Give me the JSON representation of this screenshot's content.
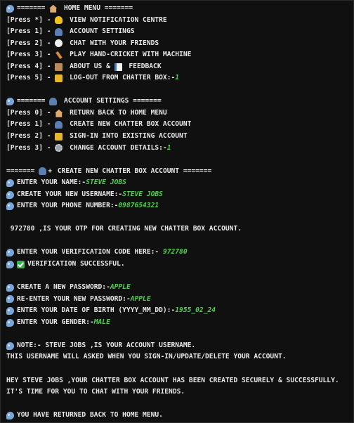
{
  "home_menu": {
    "header": "======= ",
    "header_title": " HOME MENU =======",
    "items": [
      {
        "key": "[Press *] - ",
        "label": " VIEW NOTIFICATION CENTRE",
        "icon": "bell-icon"
      },
      {
        "key": "[Press 1] - ",
        "label": " ACCOUNT SETTINGS",
        "icon": "person-icon"
      },
      {
        "key": "[Press 2] - ",
        "label": " CHAT WITH YOUR FRIENDS",
        "icon": "chat-bubble-icon"
      },
      {
        "key": "[Press 3] - ",
        "label": " PLAY HAND-CRICKET WITH MACHINE",
        "icon": "cricket-bat-icon"
      },
      {
        "key": "[Press 4] - ",
        "label": " ABOUT US & ",
        "label2": " FEEDBACK",
        "icon": "book-icon"
      },
      {
        "key": "[Press 5] - ",
        "label": " LOG-OUT FROM CHATTER BOX:-",
        "icon": "lock-icon"
      }
    ],
    "input": "1"
  },
  "account_menu": {
    "header": "======= ",
    "header_title": " ACCOUNT SETTINGS =======",
    "items": [
      {
        "key": "[Press 0] - ",
        "label": " RETURN BACK TO HOME MENU",
        "icon": "house-icon"
      },
      {
        "key": "[Press 1] - ",
        "label": " CREATE NEW CHATTER BOX ACCOUNT",
        "icon": "person-icon"
      },
      {
        "key": "[Press 2] - ",
        "label": " SIGN-IN INTO EXISTING ACCOUNT",
        "icon": "lock-key-icon"
      },
      {
        "key": "[Press 3] - ",
        "label": " CHANGE ACCOUNT DETAILS:-",
        "icon": "gear-icon"
      }
    ],
    "input": "1"
  },
  "create_account": {
    "header": "======= ",
    "header_plus": "+",
    "header_title": " CREATE NEW CHATTER BOX ACCOUNT =======",
    "name_prompt": "ENTER YOUR NAME:-",
    "name_value": "STEVE JOBS",
    "username_prompt": "CREATE YOUR NEW USERNAME:-",
    "username_value": "STEVE JOBS",
    "phone_prompt": "ENTER YOUR PHONE NUMBER:-",
    "phone_value": "0987654321",
    "otp_message": " 972780 ,IS YOUR OTP FOR CREATING NEW CHATTER BOX ACCOUNT.",
    "code_prompt": "ENTER YOUR VERIFICATION CODE HERE:- ",
    "code_value": "972780",
    "verified": "VERIFICATION SUCCESSFUL.",
    "password_prompt": "CREATE A NEW PASSWORD:-",
    "password_value": "APPLE",
    "reenter_prompt": "RE-ENTER YOUR NEW PASSWORD:-",
    "reenter_value": "APPLE",
    "dob_prompt": "ENTER YOUR DATE OF BIRTH (YYYY_MM_DD):-",
    "dob_value": "1955_02_24",
    "gender_prompt": "ENTER YOUR GENDER:-",
    "gender_value": "MALE"
  },
  "notes": {
    "note_line": "NOTE:- STEVE JOBS ,IS YOUR ACCOUNT USERNAME.",
    "note_line2": "THIS USERNAME WILL ASKED WHEN YOU SIGN-IN/UPDATE/DELETE YOUR ACCOUNT.",
    "success_line": "HEY STEVE JOBS ,YOUR CHATTER BOX ACCOUNT HAS BEEN CREATED SECURELY & SUCCESSFULLY.",
    "success_line2": "IT'S TIME FOR YOU TO CHAT WITH YOUR FRIENDS.",
    "return_line": "YOU HAVE RETURNED BACK TO HOME MENU."
  },
  "colors": {
    "background": "#101010",
    "text": "#e8e8e8",
    "input_green": "#4fd14f"
  }
}
